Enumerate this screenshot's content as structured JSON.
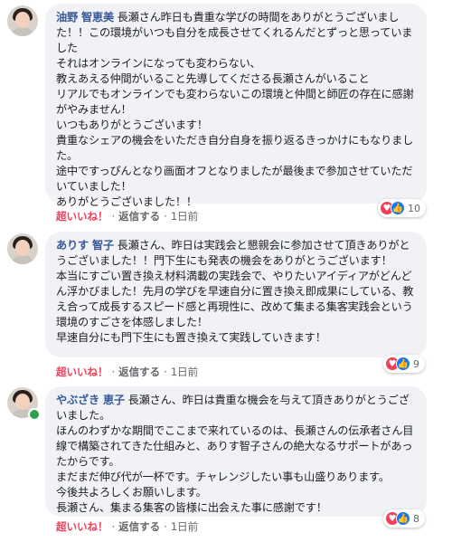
{
  "comments": [
    {
      "author": "油野 智恵美",
      "text": "長瀬さん昨日も貴重な学びの時間をありがとうございました！！この環境がいつも自分を成長させてくれるんだとずっと思っていました\nそれはオンラインになっても変わらない、\n教えあえる仲間がいること先導してくださる長瀬さんがいること\nリアルでもオンラインでも変わらないこの環境と仲間と師匠の存在に感謝がやみません！\nいつもありがとうございます！\n貴重なシェアの機会をいただき自分自身を振り返るきっかけにもなりました。\n途中ですっぴんとなり画面オフとなりましたが最後まで参加させていただいていました！\nありがとうございました！！",
      "reaction_count": "10",
      "actions": {
        "love": "超いいね！",
        "reply": "返信する",
        "time": "1日前"
      },
      "online": false
    },
    {
      "author": "ありす 智子",
      "text": "長瀬さん、昨日は実践会と懇親会に参加させて頂きありがとうございました！！門下生にも発表の機会をありがとうございます！\n本当にすごい置き換え材料満載の実践会で、やりたいアイディアがどんどん浮かびました！先月の学びを早速自分に置き換え即成果にしている、教え合って成長するスピード感と再現性に、改めて集まる集客実践会という環境のすごさを体感しました！\n早速自分にも門下生にも置き換えて実践していきます！",
      "reaction_count": "9",
      "actions": {
        "love": "超いいね！",
        "reply": "返信する",
        "time": "1日前"
      },
      "online": false
    },
    {
      "author": "やぶざき 恵子",
      "text": "長瀬さん、昨日は貴重な機会を与えて頂きありがとうございました。\nほんのわずかな期間でここまで来れているのは、長瀬さんの伝承者さん目線で構築されてきた仕組みと、ありす智子さんの絶大なるサポートがあったからです。\nまだまだ伸び代が一杯です。チャレンジしたい事も山盛りあります。\n今後共よろしくお願いします。\n長瀬さん、集まる集客の皆様に出会えた事に感謝です！",
      "reaction_count": "8",
      "actions": {
        "love": "超いいね！",
        "reply": "返信する",
        "time": "1日前"
      },
      "online": true
    }
  ],
  "separator": "·",
  "colors": {
    "author": "#385898",
    "love": "#f33e58",
    "bubble": "#f0f2f5",
    "online": "#31a24c"
  },
  "icons": {
    "heart": "heart-icon",
    "like": "thumbs-up-icon"
  }
}
